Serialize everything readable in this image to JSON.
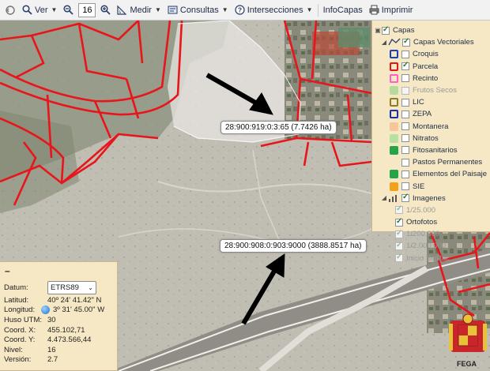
{
  "toolbar": {
    "ver_label": "Ver",
    "zoom_value": "16",
    "medir_label": "Medir",
    "consultas_label": "Consultas",
    "intersecciones_label": "Intersecciones",
    "infocapas_label": "InfoCapas",
    "imprimir_label": "Imprimir"
  },
  "map": {
    "parcel_label_1": "28:900:919:0:3:65 (7.7426 ha)",
    "parcel_label_2": "28:900:908:0:903:9000 (3888.8517 ha)",
    "fega_label": "FEGA"
  },
  "layers": {
    "root_label": "Capas",
    "vector_group": "Capas Vectoriales",
    "vector_items": [
      {
        "label": "Croquis",
        "checked": false,
        "disabled": false,
        "swatch": "#1f3fb8"
      },
      {
        "label": "Parcela",
        "checked": true,
        "disabled": false,
        "swatch": "#e3151b"
      },
      {
        "label": "Recinto",
        "checked": false,
        "disabled": false,
        "swatch": "#ff5fc7"
      },
      {
        "label": "Frutos Secos",
        "checked": false,
        "disabled": true,
        "swatch": "#9bd58d"
      },
      {
        "label": "LIC",
        "checked": false,
        "disabled": false,
        "swatch": "#8a7f26"
      },
      {
        "label": "ZEPA",
        "checked": false,
        "disabled": false,
        "swatch": "#1a2fb0"
      },
      {
        "label": "Montanera",
        "checked": false,
        "disabled": false,
        "swatch": "#f3c79a"
      },
      {
        "label": "Nitratos",
        "checked": false,
        "disabled": false,
        "swatch": "#b8e0a2"
      },
      {
        "label": "Fitosanitarios",
        "checked": false,
        "disabled": false,
        "swatch": "#27a34a"
      },
      {
        "label": "Pastos Permanentes",
        "checked": false,
        "disabled": false,
        "swatch": ""
      },
      {
        "label": "Elementos del Paisaje",
        "checked": false,
        "disabled": false,
        "swatch": "#27a34a"
      },
      {
        "label": "SIE",
        "checked": false,
        "disabled": false,
        "swatch": "#f2a11b"
      }
    ],
    "imagenes_group": "Imagenes",
    "imagenes_items": [
      {
        "label": "1/25.000",
        "checked": true,
        "disabled": true
      },
      {
        "label": "Ortofotos",
        "checked": true,
        "disabled": false
      },
      {
        "label": "1/200.000",
        "checked": true,
        "disabled": true
      },
      {
        "label": "1/2.000.000",
        "checked": true,
        "disabled": true
      },
      {
        "label": "Inicio SigPac",
        "checked": true,
        "disabled": true
      }
    ]
  },
  "info": {
    "collapse_label": "–",
    "datum_label": "Datum:",
    "datum_value": "ETRS89",
    "latitud_label": "Latitud:",
    "latitud_value": "40º 24' 41.42\" N",
    "longitud_label": "Longitud:",
    "longitud_value": "3º 31' 45.00\" W",
    "huso_label": "Huso UTM:",
    "huso_value": "30",
    "coordx_label": "Coord. X:",
    "coordx_value": "455.102,71",
    "coordy_label": "Coord. Y:",
    "coordy_value": "4.473.566,44",
    "nivel_label": "Nivel:",
    "nivel_value": "16",
    "version_label": "Versión:",
    "version_value": "2.7"
  },
  "colors": {
    "parcel_line": "#e8151b",
    "panel_bg": "#f6e8c4",
    "toolbar_bg": "#f2f2f2"
  }
}
